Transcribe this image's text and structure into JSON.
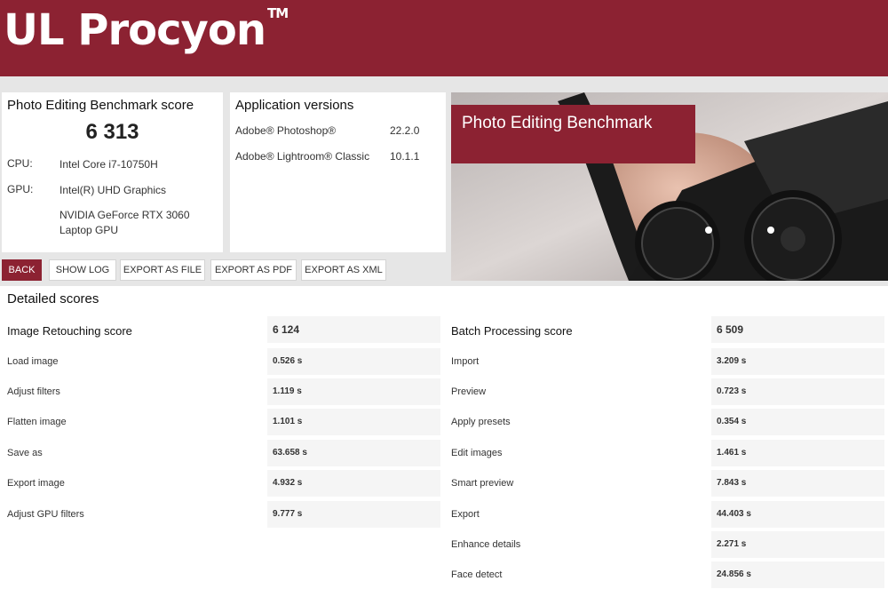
{
  "header": {
    "app_name": "UL Procyon",
    "trademark": "TM"
  },
  "score_panel": {
    "title": "Photo Editing Benchmark score",
    "score": "6 313",
    "cpu_label": "CPU:",
    "cpu_value": "Intel Core i7-10750H",
    "gpu_label": "GPU:",
    "gpu_value_1": "Intel(R) UHD Graphics",
    "gpu_value_2": "NVIDIA GeForce RTX 3060 Laptop GPU"
  },
  "versions_panel": {
    "title": "Application versions",
    "apps": [
      {
        "name": "Adobe® Photoshop®",
        "version": "22.2.0"
      },
      {
        "name": "Adobe® Lightroom® Classic",
        "version": "10.1.1"
      }
    ]
  },
  "hero": {
    "label": "Photo Editing Benchmark"
  },
  "buttons": {
    "back": "BACK",
    "show_log": "SHOW LOG",
    "export_file": "EXPORT AS FILE",
    "export_pdf": "EXPORT AS PDF",
    "export_xml": "EXPORT AS XML"
  },
  "detailed": {
    "title": "Detailed scores",
    "retouching": {
      "label": "Image Retouching score",
      "score": "6 124",
      "items": [
        {
          "label": "Load image",
          "value": "0.526 s"
        },
        {
          "label": "Adjust filters",
          "value": "1.119 s"
        },
        {
          "label": "Flatten image",
          "value": "1.101 s"
        },
        {
          "label": "Save as",
          "value": "63.658 s"
        },
        {
          "label": "Export image",
          "value": "4.932 s"
        },
        {
          "label": "Adjust GPU filters",
          "value": "9.777 s"
        }
      ]
    },
    "batch": {
      "label": "Batch Processing score",
      "score": "6 509",
      "items": [
        {
          "label": "Import",
          "value": "3.209 s"
        },
        {
          "label": "Preview",
          "value": "0.723 s"
        },
        {
          "label": "Apply presets",
          "value": "0.354 s"
        },
        {
          "label": "Edit images",
          "value": "1.461 s"
        },
        {
          "label": "Smart preview",
          "value": "7.843 s"
        },
        {
          "label": "Export",
          "value": "44.403 s"
        },
        {
          "label": "Enhance details",
          "value": "2.271 s"
        },
        {
          "label": "Face detect",
          "value": "24.856 s"
        }
      ]
    }
  }
}
